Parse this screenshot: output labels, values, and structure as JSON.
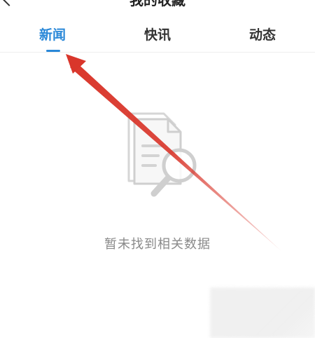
{
  "header": {
    "title": "我的收藏",
    "back_icon": "chevron-left-icon"
  },
  "tabs": [
    {
      "label": "新闻",
      "active": true
    },
    {
      "label": "快讯",
      "active": false
    },
    {
      "label": "动态",
      "active": false
    }
  ],
  "empty_state": {
    "icon": "document-search-icon",
    "message": "暂未找到相关数据"
  },
  "colors": {
    "accent": "#2a88d8",
    "annotation": "#d9362b",
    "muted_text": "#8a8a8a"
  }
}
